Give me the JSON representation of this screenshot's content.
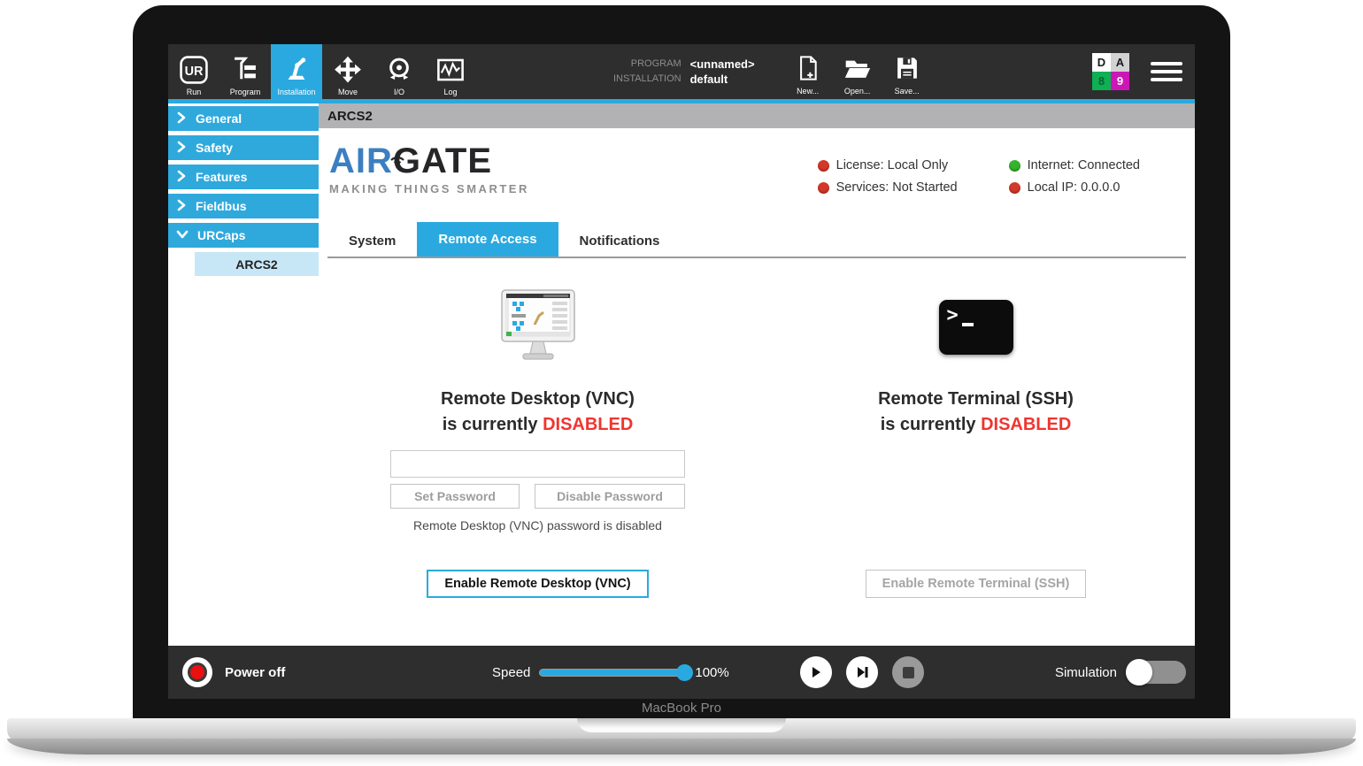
{
  "device": {
    "label": "MacBook Pro"
  },
  "toolbar": {
    "tabs": [
      {
        "label": "Run"
      },
      {
        "label": "Program"
      },
      {
        "label": "Installation",
        "active": true
      },
      {
        "label": "Move"
      },
      {
        "label": "I/O"
      },
      {
        "label": "Log"
      }
    ],
    "program_label": "PROGRAM",
    "program_value": "<unnamed>",
    "installation_label": "INSTALLATION",
    "installation_value": "default",
    "file_actions": [
      {
        "label": "New..."
      },
      {
        "label": "Open..."
      },
      {
        "label": "Save..."
      }
    ],
    "badge": {
      "cells": [
        "D",
        "A",
        "8",
        "9"
      ]
    }
  },
  "sidebar": {
    "items": [
      {
        "label": "General",
        "expanded": false
      },
      {
        "label": "Safety",
        "expanded": false
      },
      {
        "label": "Features",
        "expanded": false
      },
      {
        "label": "Fieldbus",
        "expanded": false
      },
      {
        "label": "URCaps",
        "expanded": true
      }
    ],
    "subitem": {
      "label": "ARCS2",
      "active": true
    }
  },
  "content": {
    "title_bar": "ARCS2",
    "brand": {
      "name_primary": "AIR",
      "name_secondary": "GATE",
      "tagline": "MAKING THINGS SMARTER"
    },
    "status": {
      "license": {
        "label": "License: Local Only",
        "state": "red"
      },
      "services": {
        "label": "Services: Not Started",
        "state": "red"
      },
      "internet": {
        "label": "Internet: Connected",
        "state": "green"
      },
      "local_ip": {
        "label": "Local IP: 0.0.0.0",
        "state": "red"
      }
    },
    "tabs": [
      {
        "label": "System"
      },
      {
        "label": "Remote Access",
        "active": true
      },
      {
        "label": "Notifications"
      }
    ],
    "vnc": {
      "title": "Remote Desktop (VNC)",
      "status_prefix": "is currently ",
      "status_word": "DISABLED",
      "password_value": "",
      "set_password_label": "Set Password",
      "disable_password_label": "Disable Password",
      "note": "Remote Desktop (VNC) password is disabled",
      "enable_label": "Enable Remote Desktop (VNC)"
    },
    "ssh": {
      "title": "Remote Terminal (SSH)",
      "status_prefix": "is currently ",
      "status_word": "DISABLED",
      "enable_label": "Enable Remote Terminal (SSH)"
    }
  },
  "footer": {
    "power_label": "Power off",
    "speed_label": "Speed",
    "speed_value": "100%",
    "simulation_label": "Simulation"
  },
  "colors": {
    "accent_blue": "#2aa9e0",
    "sidebar_blue": "#2fa9dc",
    "alert_red": "#f03530",
    "status_red": "#d4382a",
    "status_green": "#33b42c",
    "badge_green": "#0db052",
    "badge_magenta": "#cc17b6"
  }
}
